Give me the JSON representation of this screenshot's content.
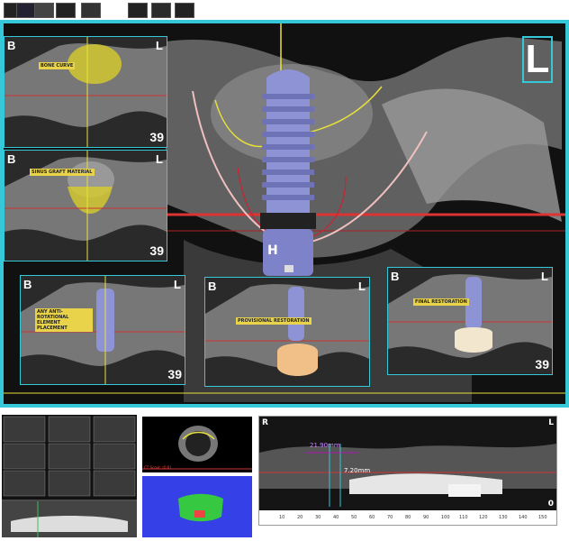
{
  "thumbnails": [
    "thumb-1",
    "thumb-2",
    "thumb-3",
    "thumb-4",
    "thumb-5",
    "thumb-6",
    "thumb-7"
  ],
  "main": {
    "orientation_label": "L",
    "implant_label": "H"
  },
  "panels": [
    {
      "id": "p1",
      "left_label": "B",
      "right_label": "L",
      "number": "39",
      "note": "BONE CURVE"
    },
    {
      "id": "p2",
      "left_label": "B",
      "right_label": "L",
      "number": "39",
      "note": "SINUS GRAFT MATERIAL"
    },
    {
      "id": "p3",
      "left_label": "B",
      "right_label": "L",
      "number": "39",
      "note": "ANY ANTI-ROTATIONAL ELEMENT PLACEMENT"
    },
    {
      "id": "p4",
      "left_label": "B",
      "right_label": "L",
      "number": "",
      "note": "PROVISIONAL RESTORATION"
    },
    {
      "id": "p5",
      "left_label": "B",
      "right_label": "L",
      "number": "39",
      "note": "FINAL RESTORATION"
    }
  ],
  "axial": {
    "caption": "CT Scout: (0,0)"
  },
  "panoramic": {
    "left_label": "R",
    "right_label": "L",
    "corner_number": "0",
    "measure_1": "21.90mm",
    "measure_2": "7.20mm",
    "ticks": [
      "10",
      "20",
      "30",
      "40",
      "50",
      "60",
      "70",
      "80",
      "90",
      "100",
      "110",
      "120",
      "130",
      "140",
      "150"
    ]
  },
  "colors": {
    "accent": "#35c8d8",
    "implant": "#8e93d6",
    "crown": "#f1c089",
    "note": "#e8d34a"
  },
  "icons": {
    "implant": "dental-implant-icon",
    "crown": "dental-crown-icon"
  }
}
